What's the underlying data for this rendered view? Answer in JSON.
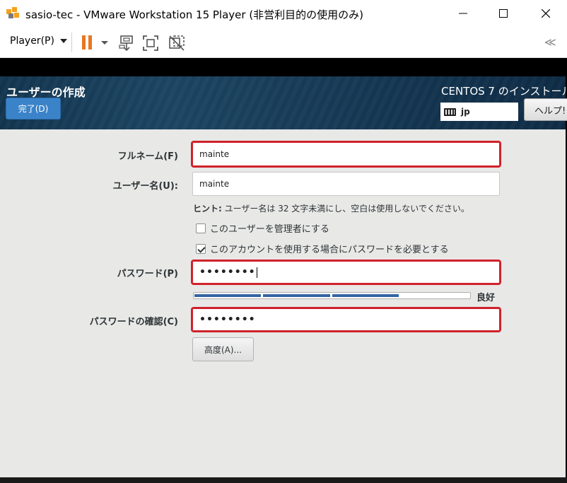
{
  "window": {
    "title": "sasio-tec - VMware Workstation 15 Player (非営利目的の使用のみ)"
  },
  "toolbar": {
    "player_menu": "Player(P)",
    "pause_color": "#e87722",
    "collapse_label": "≪"
  },
  "header": {
    "title": "ユーザーの作成",
    "done_button": "完了(D)",
    "install_title": "CENTOS 7 のインストール",
    "keyboard_layout": "jp",
    "help_button": "ヘルプ!"
  },
  "form": {
    "fullname": {
      "label": "フルネーム(F)",
      "value": "mainte"
    },
    "username": {
      "label": "ユーザー名(U):",
      "value": "mainte"
    },
    "hint": {
      "prefix": "ヒント:",
      "text": " ユーザー名は 32 文字未満にし、空白は使用しないでください。"
    },
    "admin_checkbox": {
      "label": "このユーザーを管理者にする",
      "checked": false
    },
    "require_password_checkbox": {
      "label": "このアカウントを使用する場合にパスワードを必要とする",
      "checked": true
    },
    "password": {
      "label": "パスワード(P)",
      "value": "••••••••"
    },
    "strength": {
      "label": "良好",
      "level": 0.75,
      "color": "#3465a4"
    },
    "confirm": {
      "label": "パスワードの確認(C)",
      "value": "••••••••"
    },
    "advanced_button": "高度(A)..."
  },
  "colors": {
    "highlight": "#d0212a",
    "done_button": "#3b83c9"
  }
}
